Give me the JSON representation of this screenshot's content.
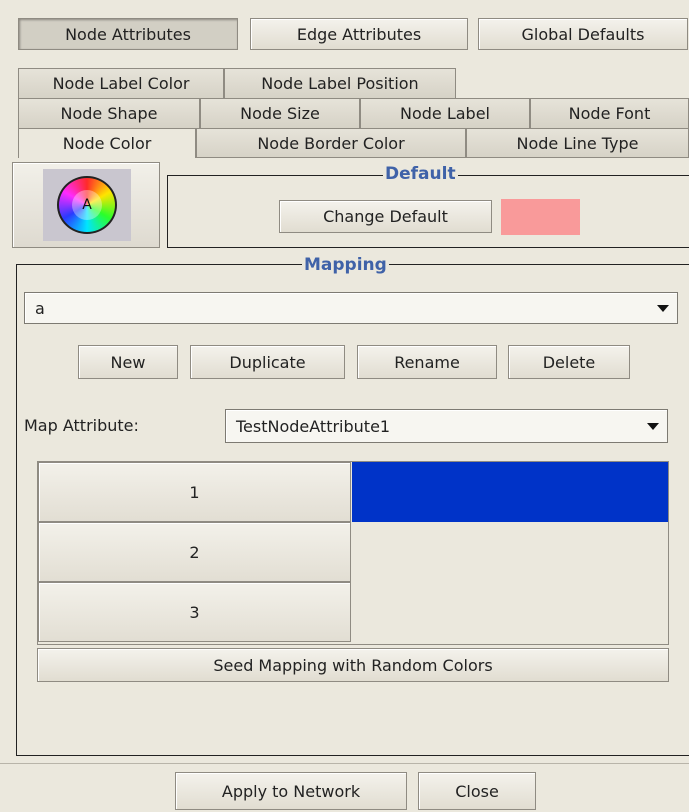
{
  "top_buttons": [
    {
      "label": "Node Attributes",
      "selected": true
    },
    {
      "label": "Edge Attributes",
      "selected": false
    },
    {
      "label": "Global Defaults",
      "selected": false
    }
  ],
  "tabs": {
    "row1": [
      "Node Label Color",
      "Node Label Position"
    ],
    "row2": [
      "Node Shape",
      "Node Size",
      "Node Label",
      "Node Font"
    ],
    "row3": [
      "Node Color",
      "Node Border Color",
      "Node Line Type"
    ],
    "selected": "Node Color"
  },
  "color_icon": {
    "icon": "color-wheel-icon",
    "letter": "A"
  },
  "default_section": {
    "legend": "Default",
    "change_default_label": "Change Default",
    "default_color": "#f99a9a"
  },
  "mapping_section": {
    "legend": "Mapping",
    "mapping_select": "a",
    "buttons": {
      "new": "New",
      "duplicate": "Duplicate",
      "rename": "Rename",
      "delete": "Delete"
    },
    "map_attribute_label": "Map Attribute:",
    "map_attribute_value": "TestNodeAttribute1",
    "rows": [
      {
        "key": "1",
        "color": "#0033c8"
      },
      {
        "key": "2",
        "color": ""
      },
      {
        "key": "3",
        "color": ""
      }
    ],
    "seed_button": "Seed Mapping with Random Colors"
  },
  "footer": {
    "apply_label": "Apply to Network",
    "close_label": "Close"
  }
}
